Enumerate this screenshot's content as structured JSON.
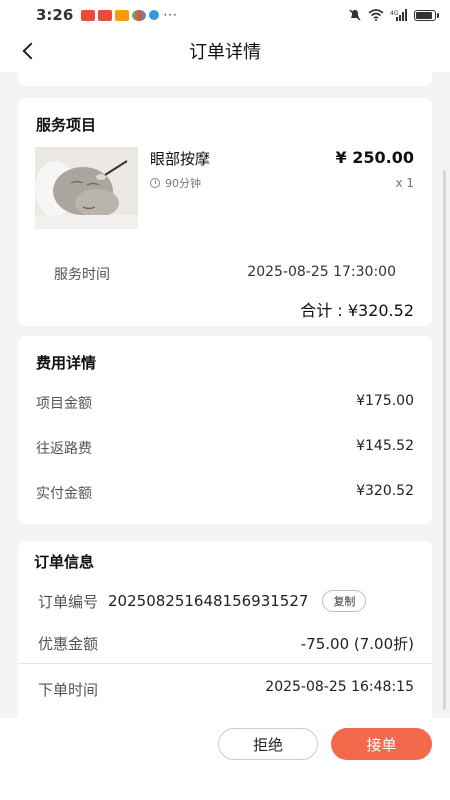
{
  "status_bar": {
    "time": "3:26",
    "overflow": "···",
    "network_label": "⁴⁶ᵢₗₗ"
  },
  "header": {
    "title": "订单详情"
  },
  "service": {
    "section_title": "服务项目",
    "name": "眼部按摩",
    "price": "¥ 250.00",
    "duration": "90分钟",
    "quantity": "x 1",
    "time_label": "服务时间",
    "time_value": "2025-08-25 17:30:00",
    "total": "合计 : ¥320.52"
  },
  "fees": {
    "section_title": "费用详情",
    "rows": [
      {
        "label": "项目金额",
        "value": "¥175.00"
      },
      {
        "label": "往返路费",
        "value": "¥145.52"
      },
      {
        "label": "实付金额",
        "value": "¥320.52"
      }
    ]
  },
  "order": {
    "section_title": "订单信息",
    "number_label": "订单编号",
    "number_value": "202508251648156931527",
    "copy_label": "复制",
    "discount_label": "优惠金额",
    "discount_value": "-75.00 (7.00折)",
    "placed_label": "下单时间",
    "placed_value": "2025-08-25 16:48:15"
  },
  "actions": {
    "reject_label": "拒绝",
    "accept_label": "接单"
  },
  "colors": {
    "accent": "#f26a4b",
    "background": "#f4f4f6"
  }
}
